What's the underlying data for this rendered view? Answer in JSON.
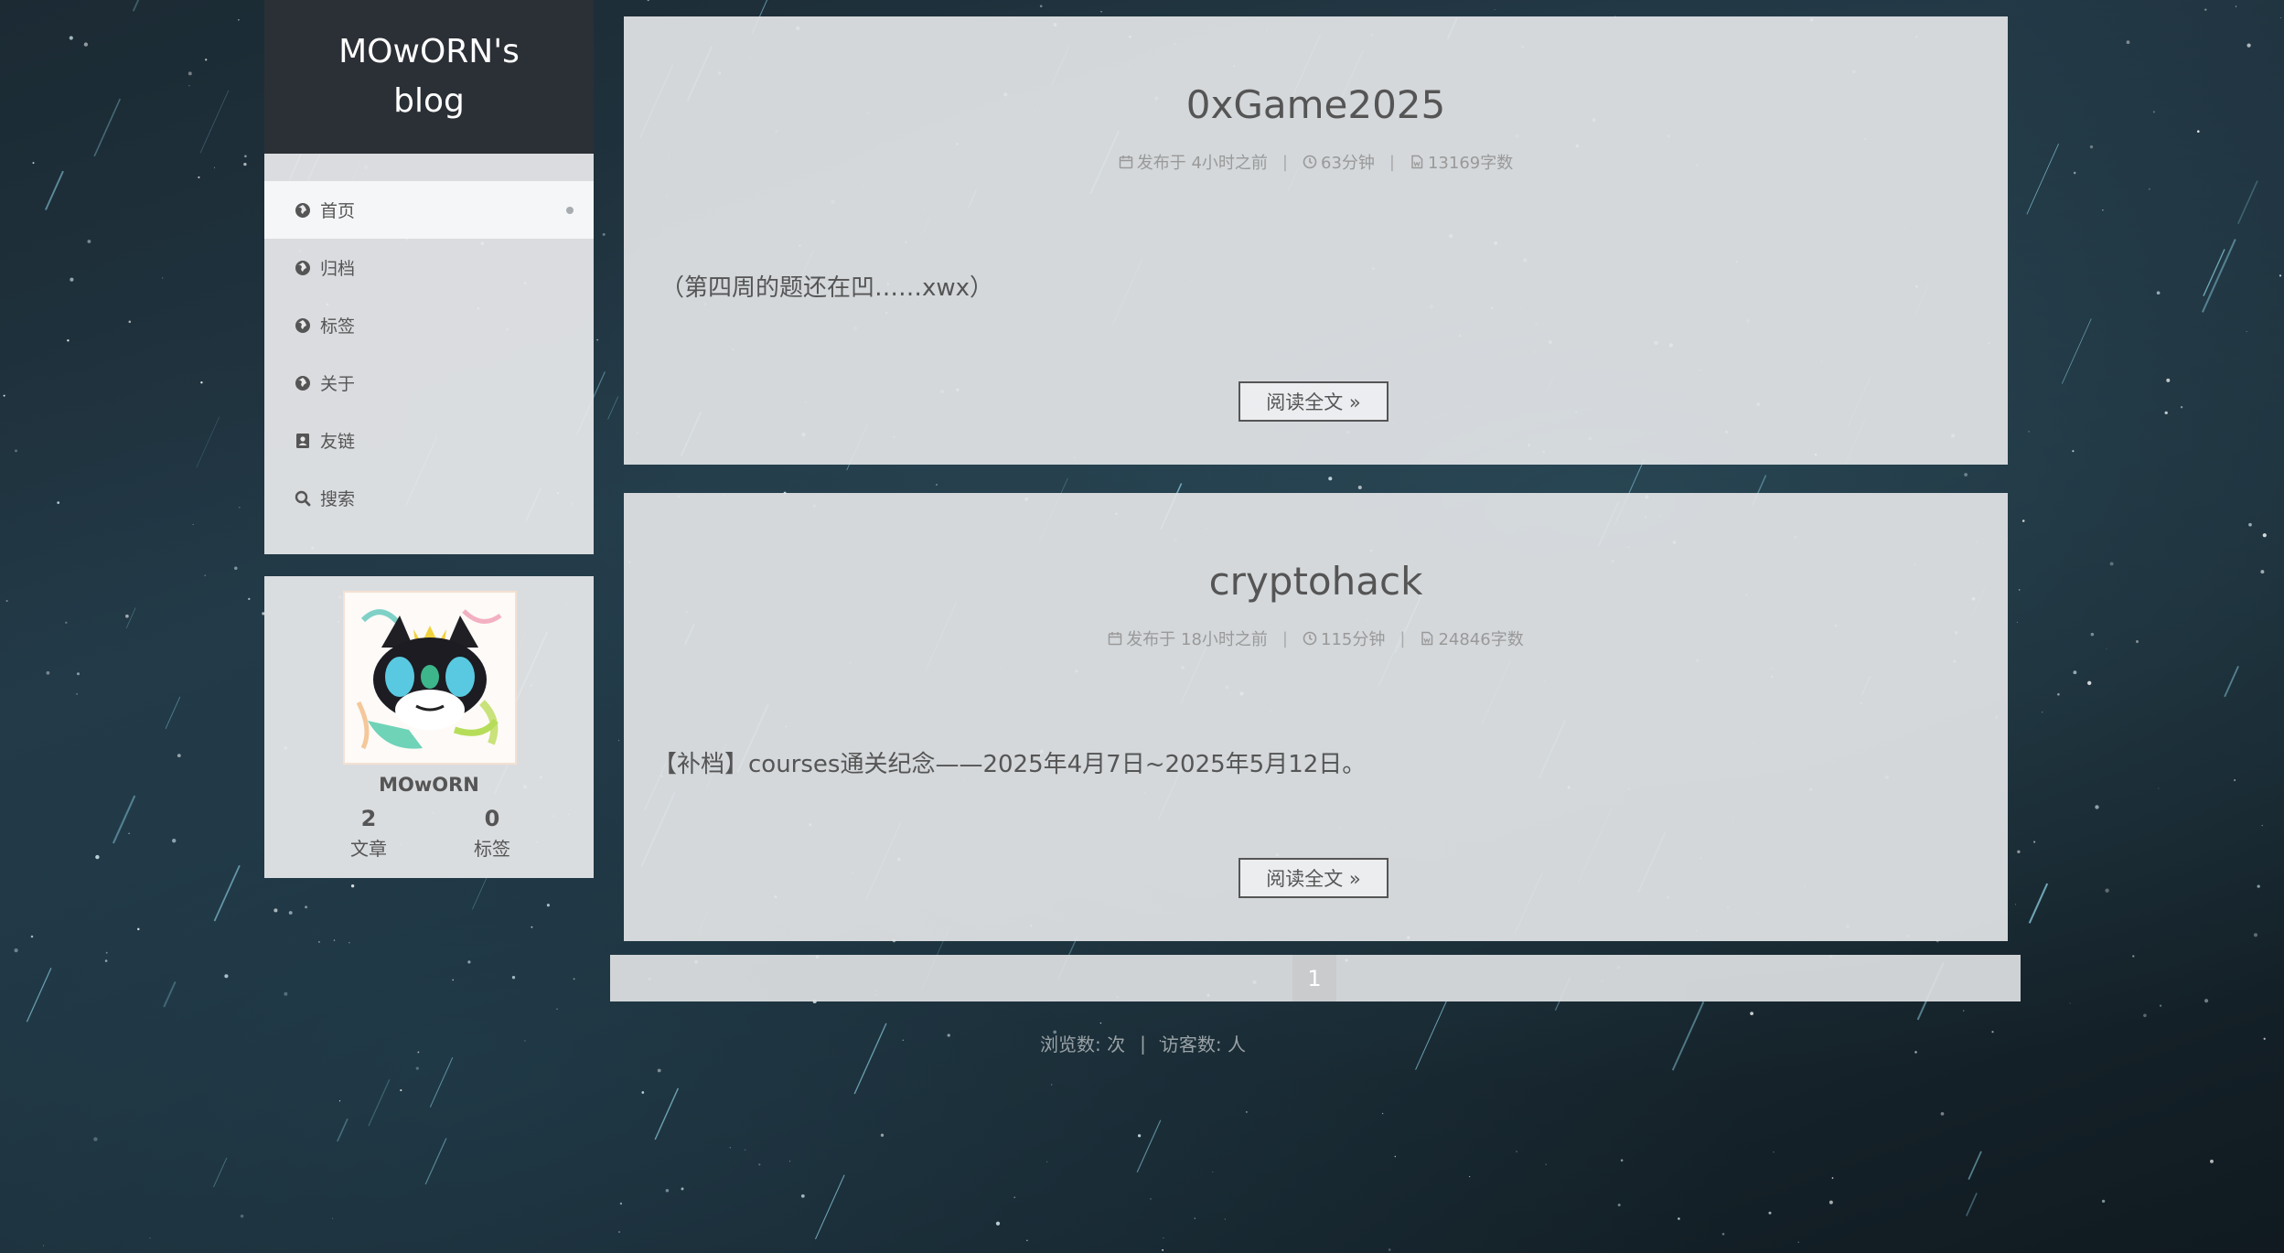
{
  "site": {
    "title": "MOwORN's blog"
  },
  "menu": {
    "items": [
      {
        "label": "首页",
        "icon": "globe-icon",
        "active": true
      },
      {
        "label": "归档",
        "icon": "globe-icon"
      },
      {
        "label": "标签",
        "icon": "globe-icon"
      },
      {
        "label": "关于",
        "icon": "globe-icon"
      },
      {
        "label": "友链",
        "icon": "contact-book-icon"
      },
      {
        "label": "搜索",
        "icon": "search-icon"
      }
    ]
  },
  "profile": {
    "name": "MOwORN",
    "articles_count": "2",
    "articles_label": "文章",
    "tags_count": "0",
    "tags_label": "标签"
  },
  "posts": [
    {
      "title": "0xGame2025",
      "published": "发布于 4小时之前",
      "read_time": "63分钟",
      "word_count": "13169字数",
      "excerpt": "（第四周的题还在凹……xwx）",
      "read_more": "阅读全文 »"
    },
    {
      "title": "cryptohack",
      "published": "发布于 18小时之前",
      "read_time": "115分钟",
      "word_count": "24846字数",
      "excerpt": "【补档】courses通关纪念——2025年4月7日~2025年5月12日。",
      "read_more": "阅读全文 »"
    }
  ],
  "meta_separator": "|",
  "pagination": {
    "current": "1"
  },
  "footer": {
    "views": "浏览数: 次",
    "separator": "|",
    "visitors": "访客数: 人"
  },
  "colors": {
    "brand_bg": "#2b2f36",
    "card_bg": "#e2e4e6",
    "text": "#555555",
    "meta_text": "#999999"
  }
}
